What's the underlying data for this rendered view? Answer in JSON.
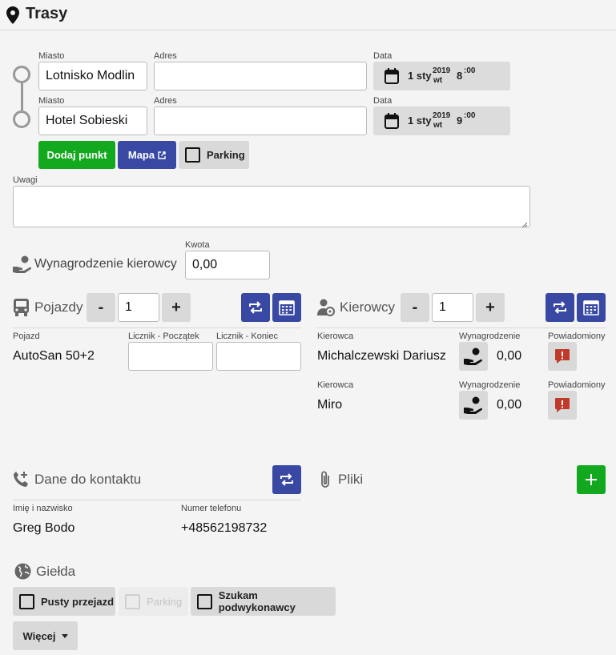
{
  "header": {
    "title": "Trasy",
    "icon": "map-pin-icon"
  },
  "route": {
    "points": [
      {
        "city_label": "Miasto",
        "city": "Lotnisko Modlin",
        "address_label": "Adres",
        "address": "",
        "date_label": "Data",
        "day": "1 sty",
        "year": "2019",
        "weekday": "wt",
        "hour": "8",
        "minute": ":00"
      },
      {
        "city_label": "Miasto",
        "city": "Hotel Sobieski",
        "address_label": "Adres",
        "address": "",
        "date_label": "Data",
        "day": "1 sty",
        "year": "2019",
        "weekday": "wt",
        "hour": "9",
        "minute": ":00"
      }
    ],
    "add_point_label": "Dodaj punkt",
    "map_label": "Mapa",
    "parking_label": "Parking",
    "notes_label": "Uwagi",
    "notes": ""
  },
  "driver_pay": {
    "label": "Wynagrodzenie kierowcy",
    "amount_label": "Kwota",
    "amount": "0,00"
  },
  "vehicles": {
    "title": "Pojazdy",
    "count": "1",
    "minus": "-",
    "plus": "+",
    "col_vehicle": "Pojazd",
    "col_start": "Licznik - Początek",
    "col_end": "Licznik - Koniec",
    "rows": [
      {
        "vehicle": "AutoSan 50+2",
        "start": "",
        "end": ""
      }
    ]
  },
  "drivers": {
    "title": "Kierowcy",
    "count": "1",
    "minus": "-",
    "plus": "+",
    "rows": [
      {
        "driver_label": "Kierowca",
        "driver": "Michalczewski Dariusz",
        "pay_label": "Wynagrodzenie",
        "pay": "0,00",
        "notified_label": "Powiadomiony"
      },
      {
        "driver_label": "Kierowca",
        "driver": "Miro",
        "pay_label": "Wynagrodzenie",
        "pay": "0,00",
        "notified_label": "Powiadomiony"
      }
    ]
  },
  "contact": {
    "title": "Dane do kontaktu",
    "name_label": "Imię i nazwisko",
    "name": "Greg Bodo",
    "phone_label": "Numer telefonu",
    "phone": "+48562198732"
  },
  "files": {
    "title": "Pliki"
  },
  "exchange": {
    "title": "Giełda",
    "empty_ride": "Pusty przejazd",
    "parking": "Parking",
    "subcontractor": "Szukam podwykonawcy",
    "more": "Więcej"
  },
  "colors": {
    "green": "#13a91e",
    "blue": "#3949a3",
    "red": "#c0392b",
    "grey": "#d9d9d9"
  }
}
